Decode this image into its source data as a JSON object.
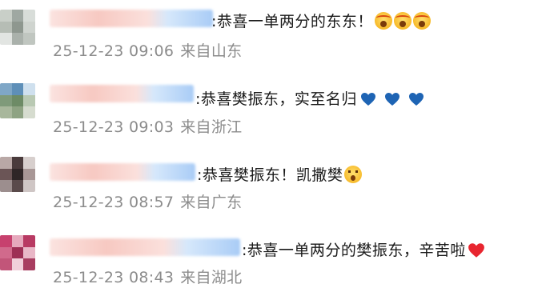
{
  "comments": [
    {
      "text": ":恭喜一单两分的东东！",
      "time": "25-12-23 09:06",
      "location": "来自山东",
      "emoji": [
        "scream-icon",
        "scream-icon",
        "scream-icon"
      ],
      "avatar": [
        "#c9cfc8",
        "#9fa8a2",
        "#d8ddd9",
        "#b6bdb5",
        "#8e978f",
        "#cfd4cf",
        "#e2e5e2",
        "#aab1ab",
        "#c0c6c0"
      ]
    },
    {
      "text": ":恭喜樊振东，实至名归",
      "time": "25-12-23 09:03",
      "location": "来自浙江",
      "emoji": [
        "blue-heart-icon",
        "blue-heart-icon",
        "blue-heart-icon"
      ],
      "avatar": [
        "#7fa7c7",
        "#5e8fb8",
        "#cfe0ee",
        "#7f9a7a",
        "#6d8b66",
        "#b9c9b3",
        "#a8b79c",
        "#8ea383",
        "#d6dccf"
      ]
    },
    {
      "text": ":恭喜樊振东！凯撒樊",
      "time": "25-12-23 08:57",
      "location": "来自广东",
      "emoji": [
        "astonished-icon"
      ],
      "avatar": [
        "#b9a8a6",
        "#4a3b3c",
        "#d7cfcd",
        "#6b5556",
        "#2f2627",
        "#a89796",
        "#9c8e8e",
        "#5a4a4b",
        "#cfc6c5"
      ]
    },
    {
      "text": ":恭喜一单两分的樊振东，辛苦啦",
      "time": "25-12-23 08:43",
      "location": "来自湖北",
      "emoji": [
        "red-heart-icon"
      ],
      "avatar": [
        "#c7416e",
        "#e6a9bd",
        "#b83a63",
        "#d16a8c",
        "#9e2f55",
        "#e9b7c7",
        "#c25579",
        "#f1cfda",
        "#a83d60"
      ]
    }
  ]
}
